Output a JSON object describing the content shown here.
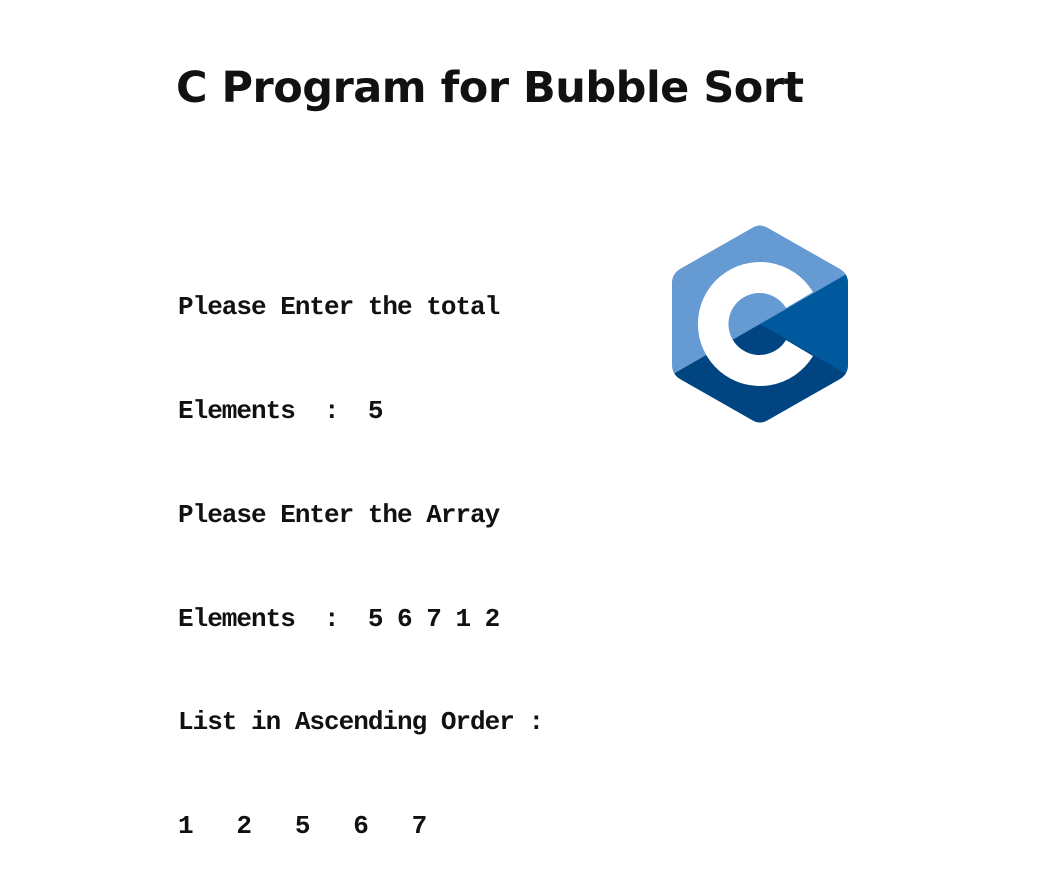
{
  "title": "C Program for Bubble Sort",
  "console": {
    "lines": [
      "Please Enter the total",
      "Elements  :  5",
      "Please Enter the Array",
      "Elements  :  5 6 7 1 2",
      "List in Ascending Order :",
      "1   2   5   6   7"
    ]
  },
  "logo": {
    "icon": "c-language-logo-icon",
    "colors": {
      "light": "#659ad2",
      "medium": "#00599c",
      "dark": "#004482",
      "letter": "#ffffff"
    }
  }
}
